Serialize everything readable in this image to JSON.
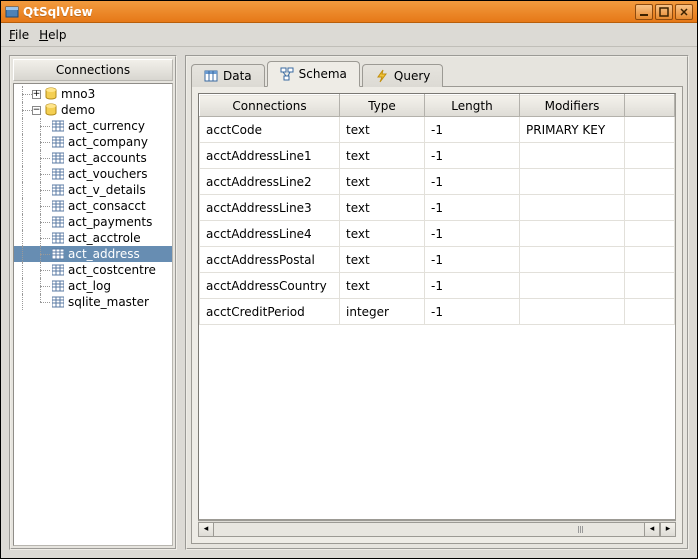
{
  "window": {
    "title": "QtSqlView"
  },
  "menubar": {
    "file": {
      "label": "File",
      "ul": "F"
    },
    "help": {
      "label": "Help",
      "ul": "H"
    }
  },
  "sidebar": {
    "header": "Connections",
    "nodes": [
      {
        "label": "mno3",
        "type": "db",
        "expand": "+"
      },
      {
        "label": "demo",
        "type": "db",
        "expand": "-"
      }
    ],
    "tables": [
      "act_currency",
      "act_company",
      "act_accounts",
      "act_vouchers",
      "act_v_details",
      "act_consacct",
      "act_payments",
      "act_acctrole",
      "act_address",
      "act_costcentre",
      "act_log",
      "sqlite_master"
    ],
    "selected_index": 8
  },
  "tabs": {
    "items": [
      {
        "label": "Data",
        "icon": "table-icon"
      },
      {
        "label": "Schema",
        "icon": "schema-icon"
      },
      {
        "label": "Query",
        "icon": "bolt-icon"
      }
    ],
    "active_index": 1
  },
  "schema": {
    "headers": [
      "Connections",
      "Type",
      "Length",
      "Modifiers",
      ""
    ],
    "rows": [
      {
        "c0": "acctCode",
        "c1": "text",
        "c2": "-1",
        "c3": "PRIMARY KEY"
      },
      {
        "c0": "acctAddressLine1",
        "c1": "text",
        "c2": "-1",
        "c3": ""
      },
      {
        "c0": "acctAddressLine2",
        "c1": "text",
        "c2": "-1",
        "c3": ""
      },
      {
        "c0": "acctAddressLine3",
        "c1": "text",
        "c2": "-1",
        "c3": ""
      },
      {
        "c0": "acctAddressLine4",
        "c1": "text",
        "c2": "-1",
        "c3": ""
      },
      {
        "c0": "acctAddressPostal",
        "c1": "text",
        "c2": "-1",
        "c3": ""
      },
      {
        "c0": "acctAddressCountry",
        "c1": "text",
        "c2": "-1",
        "c3": ""
      },
      {
        "c0": "acctCreditPeriod",
        "c1": "integer",
        "c2": "-1",
        "c3": ""
      }
    ]
  }
}
